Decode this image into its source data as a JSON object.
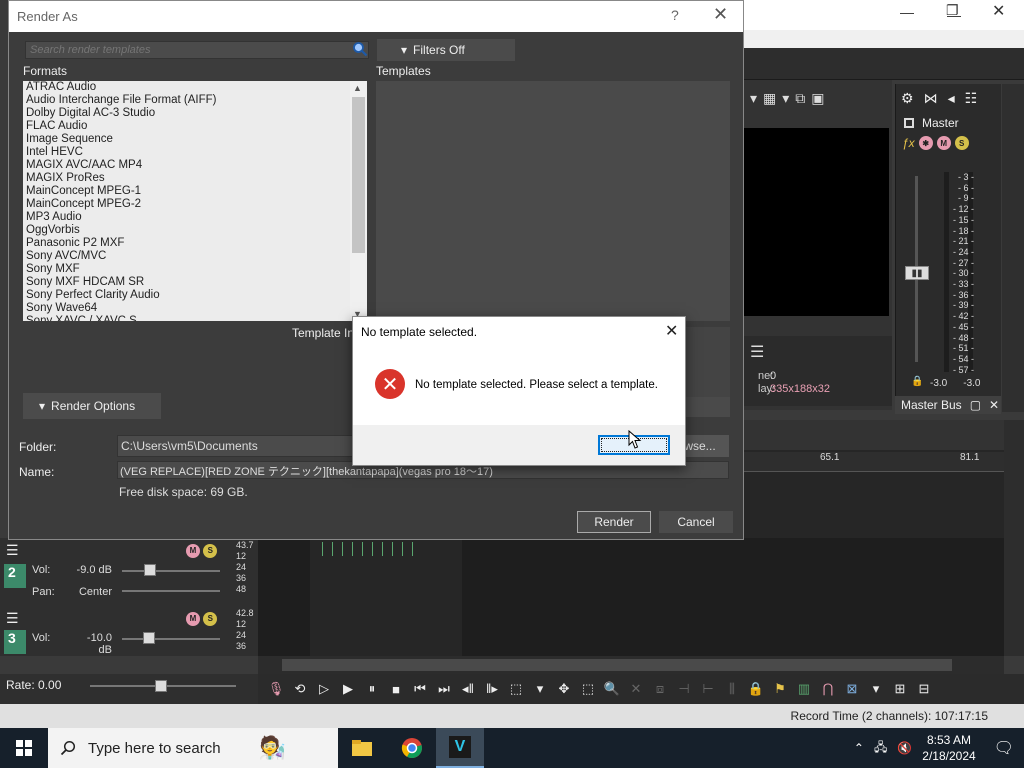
{
  "render_dialog": {
    "title": "Render As",
    "search_placeholder": "Search render templates",
    "filters_label": "Filters Off",
    "formats_label": "Formats",
    "templates_label": "Templates",
    "formats": [
      "ATRAC Audio",
      "Audio Interchange File Format (AIFF)",
      "Dolby Digital AC-3 Studio",
      "FLAC Audio",
      "Image Sequence",
      "Intel HEVC",
      "MAGIX AVC/AAC MP4",
      "MAGIX ProRes",
      "MainConcept MPEG-1",
      "MainConcept MPEG-2",
      "MP3 Audio",
      "OggVorbis",
      "Panasonic P2 MXF",
      "Sony AVC/MVC",
      "Sony MXF",
      "Sony MXF HDCAM SR",
      "Sony Perfect Clarity Audio",
      "Sony Wave64",
      "Sony XAVC / XAVC S"
    ],
    "template_info_label": "Template Inf",
    "render_options_label": "Render Options",
    "folder_label": "Folder:",
    "folder_value": "C:\\Users\\vm5\\Documents",
    "browse_label": "wse...",
    "name_label": "Name:",
    "name_value": "(VEG REPLACE)[RED ZONE テクニック][thekantapapa](vegas pro 18～17)",
    "free_space": "Free disk space: 69 GB.",
    "render_label": "Render",
    "cancel_label": "Cancel"
  },
  "message_box": {
    "title": "No template selected.",
    "message": "No template selected.  Please select a template."
  },
  "preview": {
    "frame_label": "ne:",
    "frame_value": "0",
    "display_label": "lay:",
    "display_value": "335x188x32"
  },
  "master": {
    "label": "Master",
    "meter_scale": [
      "3",
      "6",
      "9",
      "12",
      "15",
      "18",
      "21",
      "24",
      "27",
      "30",
      "33",
      "36",
      "39",
      "42",
      "45",
      "48",
      "51",
      "54",
      "57"
    ],
    "peak_left": "-3.0",
    "peak_right": "-3.0",
    "bus_tab": "Master Bus"
  },
  "timeline": {
    "ruler": [
      "",
      "65.1",
      "81.1"
    ],
    "rate": "Rate: 0.00"
  },
  "tracks": [
    {
      "number": "2",
      "vol_label": "Vol:",
      "vol_value": "-9.0 dB",
      "pan_label": "Pan:",
      "pan_value": "Center",
      "scale": [
        "43.7",
        "12",
        "24",
        "36",
        "48"
      ]
    },
    {
      "number": "3",
      "vol_label": "Vol:",
      "vol_value": "-10.0 dB",
      "scale": [
        "42.8",
        "12",
        "24",
        "36"
      ]
    }
  ],
  "status": {
    "record_time": "Record Time (2 channels): 107:17:15"
  },
  "taskbar": {
    "search_placeholder": "Type here to search",
    "time": "8:53 AM",
    "date": "2/18/2024"
  }
}
